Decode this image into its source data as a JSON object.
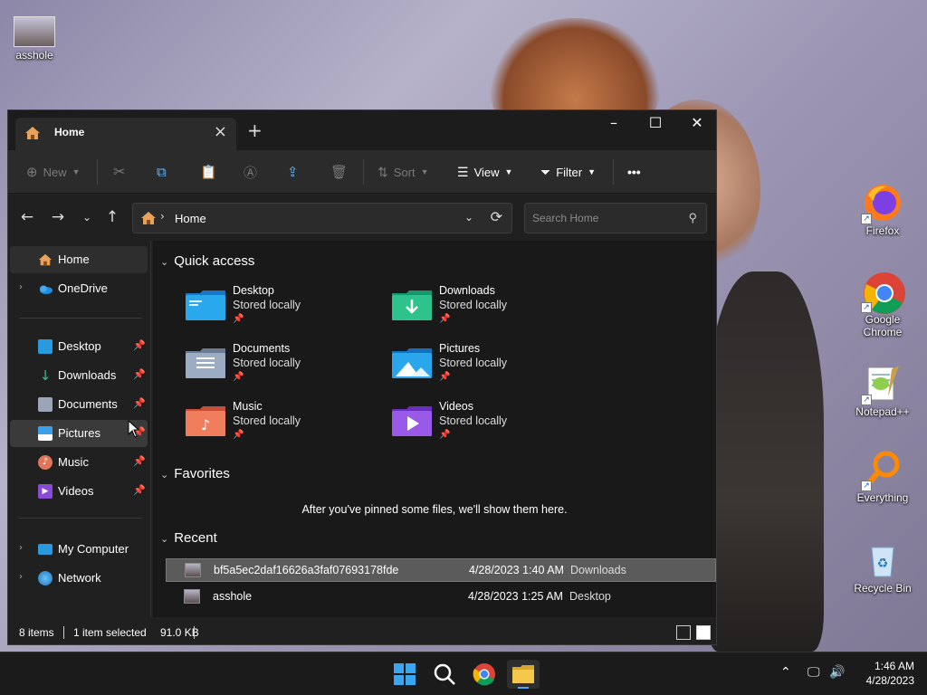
{
  "desktop": {
    "icons": [
      {
        "name": "asshole"
      },
      {
        "name": "Firefox"
      },
      {
        "name": "Google Chrome"
      },
      {
        "name": "Notepad++"
      },
      {
        "name": "Everything"
      },
      {
        "name": "Recycle Bin"
      }
    ]
  },
  "window": {
    "tab_title": "Home",
    "toolbar": {
      "new": "New",
      "sort": "Sort",
      "view": "View",
      "filter": "Filter",
      "more": "•••"
    },
    "address": {
      "location": "Home",
      "search_placeholder": "Search Home"
    },
    "nav": {
      "home": "Home",
      "onedrive": "OneDrive",
      "pinned": [
        "Desktop",
        "Downloads",
        "Documents",
        "Pictures",
        "Music",
        "Videos"
      ],
      "my_computer": "My Computer",
      "network": "Network"
    },
    "quick_access": {
      "heading": "Quick access",
      "items": [
        {
          "name": "Desktop",
          "status": "Stored locally"
        },
        {
          "name": "Downloads",
          "status": "Stored locally"
        },
        {
          "name": "Documents",
          "status": "Stored locally"
        },
        {
          "name": "Pictures",
          "status": "Stored locally"
        },
        {
          "name": "Music",
          "status": "Stored locally"
        },
        {
          "name": "Videos",
          "status": "Stored locally"
        }
      ]
    },
    "favorites": {
      "heading": "Favorites",
      "empty_message": "After you've pinned some files, we'll show them here."
    },
    "recent": {
      "heading": "Recent",
      "rows": [
        {
          "name": "bf5a5ec2daf16626a3faf07693178fde",
          "date": "4/28/2023 1:40 AM",
          "location": "Downloads"
        },
        {
          "name": "asshole",
          "date": "4/28/2023 1:25 AM",
          "location": "Desktop"
        }
      ]
    },
    "status": {
      "items": "8 items",
      "selected": "1 item selected",
      "size": "91.0 KB"
    }
  },
  "taskbar": {
    "time": "1:46 AM",
    "date": "4/28/2023"
  },
  "colors": {
    "window_bg": "#202020",
    "content_bg": "#191919",
    "selection": "#5b5b5b",
    "accent": "#0078d4"
  }
}
